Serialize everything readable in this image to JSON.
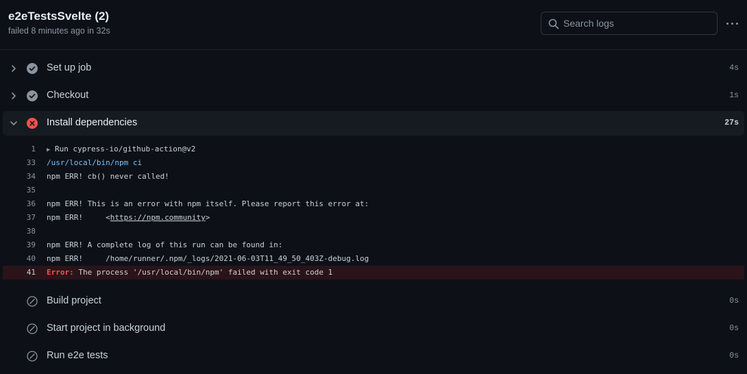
{
  "job": {
    "title": "e2eTestsSvelte (2)",
    "status": "failed 8 minutes ago in 32s"
  },
  "search": {
    "placeholder": "Search logs"
  },
  "colors": {
    "success": "#8b949e",
    "failure": "#f85149",
    "background": "#0d1117"
  },
  "steps": [
    {
      "label": "Set up job",
      "duration": "4s",
      "state": "success",
      "expanded": false
    },
    {
      "label": "Checkout",
      "duration": "1s",
      "state": "success",
      "expanded": false
    },
    {
      "label": "Install dependencies",
      "duration": "27s",
      "state": "failure",
      "expanded": true
    },
    {
      "label": "Build project",
      "duration": "0s",
      "state": "skipped",
      "expanded": false
    },
    {
      "label": "Start project in background",
      "duration": "0s",
      "state": "skipped",
      "expanded": false
    },
    {
      "label": "Run e2e tests",
      "duration": "0s",
      "state": "skipped",
      "expanded": false
    }
  ],
  "log": [
    {
      "n": "1",
      "text": "Run cypress-io/github-action@v2",
      "kind": "group"
    },
    {
      "n": "33",
      "text": "/usr/local/bin/npm ci",
      "kind": "cmd"
    },
    {
      "n": "34",
      "text": "npm ERR! cb() never called!",
      "kind": "plain"
    },
    {
      "n": "35",
      "text": "",
      "kind": "plain"
    },
    {
      "n": "36",
      "text": "npm ERR! This is an error with npm itself. Please report this error at:",
      "kind": "plain"
    },
    {
      "n": "37",
      "text": "npm ERR!     <",
      "link": "https://npm.community",
      "after": ">",
      "kind": "link"
    },
    {
      "n": "38",
      "text": "",
      "kind": "plain"
    },
    {
      "n": "39",
      "text": "npm ERR! A complete log of this run can be found in:",
      "kind": "plain"
    },
    {
      "n": "40",
      "text": "npm ERR!     /home/runner/.npm/_logs/2021-06-03T11_49_50_403Z-debug.log",
      "kind": "plain"
    },
    {
      "n": "41",
      "label": "Error:",
      "text": " The process '/usr/local/bin/npm' failed with exit code 1",
      "kind": "err"
    }
  ]
}
